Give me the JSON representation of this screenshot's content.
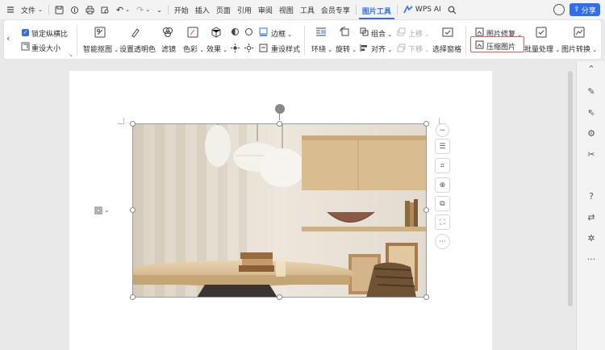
{
  "menubar": {
    "file_label": "文件",
    "tabs": [
      "开始",
      "插入",
      "页面",
      "引用",
      "审阅",
      "视图",
      "工具",
      "会员专享"
    ],
    "active_tab": "图片工具",
    "wps_ai": "WPS AI",
    "share": "分享"
  },
  "ribbon": {
    "lock_ratio": "锁定纵横比",
    "reset_size": "重设大小",
    "smart_cutout": "智能抠图",
    "set_transparent": "设置透明色",
    "filter": "滤镜",
    "color": "色彩",
    "effects": "效果",
    "border": "边框",
    "reset_style": "重设样式",
    "wrap": "环绕",
    "rotate": "旋转",
    "group": "组合",
    "align": "对齐",
    "move_up": "上移",
    "move_down": "下移",
    "selection_pane": "选择窗格",
    "image_repair": "图片修复",
    "compress_image": "压缩图片",
    "batch_process": "批量处理",
    "image_convert": "图片转换"
  },
  "colors": {
    "accent": "#2f6fed",
    "highlight": "#e8604c"
  }
}
